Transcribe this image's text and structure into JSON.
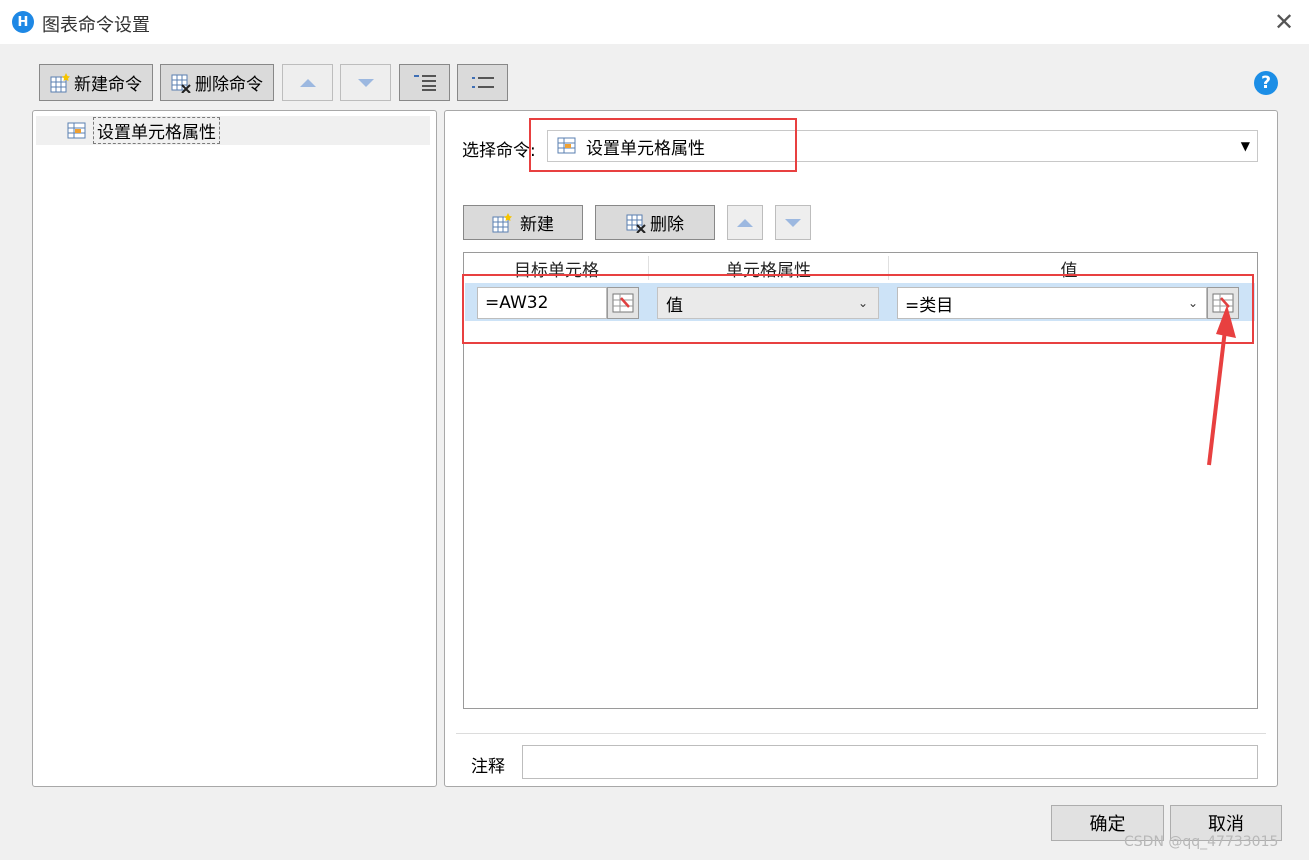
{
  "window": {
    "title": "图表命令设置",
    "app_icon": "H"
  },
  "toolbar": {
    "new_command": "新建命令",
    "delete_command": "删除命令"
  },
  "tree": {
    "items": [
      {
        "label": "设置单元格属性"
      }
    ]
  },
  "right": {
    "select_label": "选择命令:",
    "select_value": "设置单元格属性",
    "new": "新建",
    "delete": "删除",
    "columns": [
      "目标单元格",
      "单元格属性",
      "值"
    ],
    "rows": [
      {
        "target": "=AW32",
        "property": "值",
        "value": "=类目"
      }
    ],
    "note_label": "注释",
    "note_value": ""
  },
  "footer": {
    "ok": "确定",
    "cancel": "取消"
  },
  "watermark": "CSDN @qq_47733015",
  "colors": {
    "accent": "#1e88e5",
    "annotation": "#e84040",
    "selection": "#cde3f7"
  }
}
